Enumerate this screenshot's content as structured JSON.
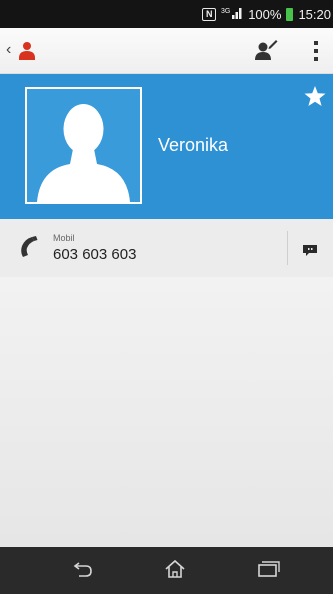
{
  "status_bar": {
    "nfc_icon_text": "N",
    "signal": "3G",
    "battery": "100%",
    "time": "15:20"
  },
  "action_bar": {
    "icons": [
      "back-icon",
      "contacts-app-icon",
      "add-contact-icon",
      "overflow-menu-icon"
    ]
  },
  "contact": {
    "name": "Veronika",
    "favorite": true,
    "phone_type": "Mobil",
    "phone_number": "603 603 603"
  },
  "colors": {
    "header_blue": "#2e91d3",
    "status_bar": "#141414",
    "nav_bar": "#2a2a2a",
    "battery_green": "#48c24b"
  },
  "nav_bar": {
    "icons": [
      "back-icon",
      "home-icon",
      "recents-icon"
    ]
  }
}
